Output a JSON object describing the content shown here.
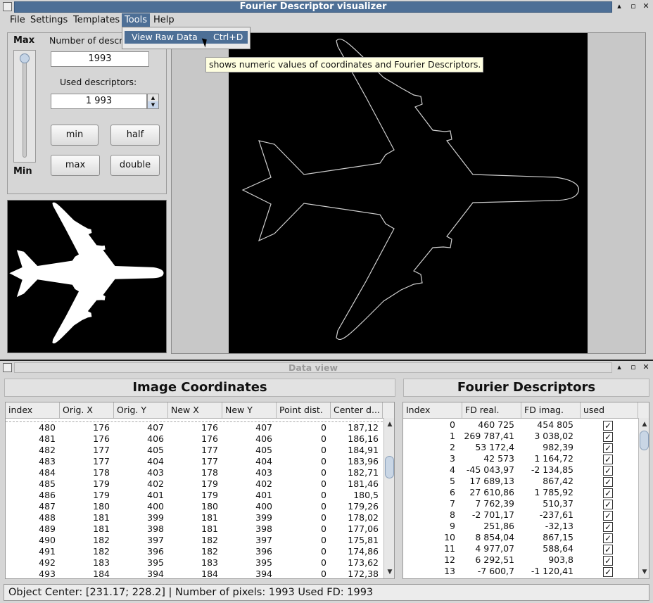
{
  "main_window": {
    "title": "Fourier Descriptor visualizer",
    "controls": {
      "minimize": "▴",
      "maximize": "▫",
      "close": "✕"
    }
  },
  "menubar": {
    "items": [
      {
        "label": "File"
      },
      {
        "label": "Settings"
      },
      {
        "label": "Templates"
      },
      {
        "label": "Tools"
      },
      {
        "label": "Help"
      }
    ]
  },
  "tools_menu": {
    "item_label": "View Raw Data",
    "item_shortcut": "Ctrl+D"
  },
  "tooltip": "shows numeric values of coordinates and Fourier Descriptors.",
  "controls": {
    "slider_max_label": "Max",
    "slider_min_label": "Min",
    "number_of_descriptors_label": "Number of descriptors:",
    "number_of_descriptors_value": "1993",
    "used_descriptors_label": "Used descriptors:",
    "used_descriptors_value": "1 993",
    "buttons": {
      "min": "min",
      "half": "half",
      "max": "max",
      "double": "double"
    }
  },
  "data_view": {
    "title": "Data view",
    "coords": {
      "title": "Image Coordinates",
      "columns": [
        "index",
        "Orig. X",
        "Orig. Y",
        "New X",
        "New Y",
        "Point dist.",
        "Center d..."
      ],
      "rows": [
        [
          "480",
          "176",
          "407",
          "176",
          "407",
          "0",
          "187,12"
        ],
        [
          "481",
          "176",
          "406",
          "176",
          "406",
          "0",
          "186,16"
        ],
        [
          "482",
          "177",
          "405",
          "177",
          "405",
          "0",
          "184,91"
        ],
        [
          "483",
          "177",
          "404",
          "177",
          "404",
          "0",
          "183,96"
        ],
        [
          "484",
          "178",
          "403",
          "178",
          "403",
          "0",
          "182,71"
        ],
        [
          "485",
          "179",
          "402",
          "179",
          "402",
          "0",
          "181,46"
        ],
        [
          "486",
          "179",
          "401",
          "179",
          "401",
          "0",
          "180,5"
        ],
        [
          "487",
          "180",
          "400",
          "180",
          "400",
          "0",
          "179,26"
        ],
        [
          "488",
          "181",
          "399",
          "181",
          "399",
          "0",
          "178,02"
        ],
        [
          "489",
          "181",
          "398",
          "181",
          "398",
          "0",
          "177,06"
        ],
        [
          "490",
          "182",
          "397",
          "182",
          "397",
          "0",
          "175,81"
        ],
        [
          "491",
          "182",
          "396",
          "182",
          "396",
          "0",
          "174,86"
        ],
        [
          "492",
          "183",
          "395",
          "183",
          "395",
          "0",
          "173,62"
        ],
        [
          "493",
          "184",
          "394",
          "184",
          "394",
          "0",
          "172,38"
        ]
      ]
    },
    "fd": {
      "title": "Fourier Descriptors",
      "columns": [
        "Index",
        "FD real.",
        "FD imag.",
        "used"
      ],
      "rows": [
        [
          "0",
          "460 725",
          "454 805"
        ],
        [
          "1",
          "269 787,41",
          "3 038,02"
        ],
        [
          "2",
          "53 172,4",
          "982,39"
        ],
        [
          "3",
          "42 573",
          "1 164,72"
        ],
        [
          "4",
          "-45 043,97",
          "-2 134,85"
        ],
        [
          "5",
          "17 689,13",
          "867,42"
        ],
        [
          "6",
          "27 610,86",
          "1 785,92"
        ],
        [
          "7",
          "7 762,39",
          "510,37"
        ],
        [
          "8",
          "-2 701,17",
          "-237,61"
        ],
        [
          "9",
          "251,86",
          "-32,13"
        ],
        [
          "10",
          "8 854,04",
          "867,15"
        ],
        [
          "11",
          "4 977,07",
          "588,64"
        ],
        [
          "12",
          "6 292,51",
          "903,8"
        ],
        [
          "13",
          "-7 600,7",
          "-1 120,41"
        ]
      ],
      "used_mark": "✓"
    }
  },
  "status_bar": "Object Center: [231.17; 228.2] | Number of pixels: 1993  Used FD: 1993"
}
